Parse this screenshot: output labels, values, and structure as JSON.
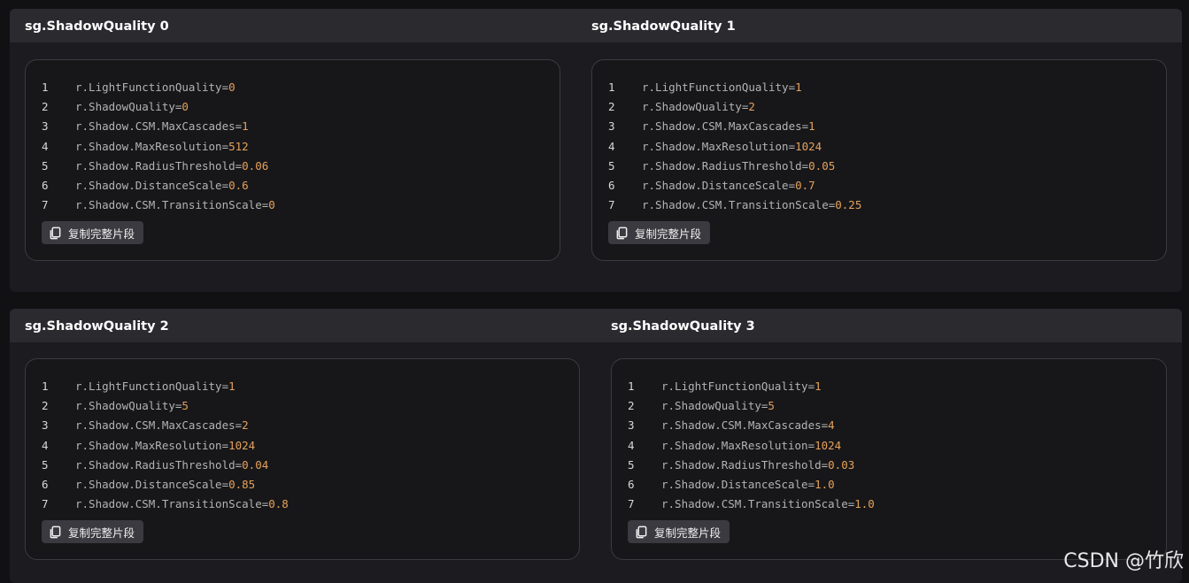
{
  "blocks": [
    {
      "columns": [
        {
          "title": "sg.ShadowQuality 0",
          "copy_label": "复制完整片段",
          "lines": [
            {
              "num": "1",
              "key": "r.LightFunctionQuality",
              "val": "0"
            },
            {
              "num": "2",
              "key": "r.ShadowQuality",
              "val": "0"
            },
            {
              "num": "3",
              "key": "r.Shadow.CSM.MaxCascades",
              "val": "1"
            },
            {
              "num": "4",
              "key": "r.Shadow.MaxResolution",
              "val": "512"
            },
            {
              "num": "5",
              "key": "r.Shadow.RadiusThreshold",
              "val": "0.06"
            },
            {
              "num": "6",
              "key": "r.Shadow.DistanceScale",
              "val": "0.6"
            },
            {
              "num": "7",
              "key": "r.Shadow.CSM.TransitionScale",
              "val": "0"
            }
          ]
        },
        {
          "title": "sg.ShadowQuality 1",
          "copy_label": "复制完整片段",
          "lines": [
            {
              "num": "1",
              "key": "r.LightFunctionQuality",
              "val": "1"
            },
            {
              "num": "2",
              "key": "r.ShadowQuality",
              "val": "2"
            },
            {
              "num": "3",
              "key": "r.Shadow.CSM.MaxCascades",
              "val": "1"
            },
            {
              "num": "4",
              "key": "r.Shadow.MaxResolution",
              "val": "1024"
            },
            {
              "num": "5",
              "key": "r.Shadow.RadiusThreshold",
              "val": "0.05"
            },
            {
              "num": "6",
              "key": "r.Shadow.DistanceScale",
              "val": "0.7"
            },
            {
              "num": "7",
              "key": "r.Shadow.CSM.TransitionScale",
              "val": "0.25"
            }
          ]
        }
      ]
    },
    {
      "columns": [
        {
          "title": "sg.ShadowQuality 2",
          "copy_label": "复制完整片段",
          "lines": [
            {
              "num": "1",
              "key": "r.LightFunctionQuality",
              "val": "1"
            },
            {
              "num": "2",
              "key": "r.ShadowQuality",
              "val": "5"
            },
            {
              "num": "3",
              "key": "r.Shadow.CSM.MaxCascades",
              "val": "2"
            },
            {
              "num": "4",
              "key": "r.Shadow.MaxResolution",
              "val": "1024"
            },
            {
              "num": "5",
              "key": "r.Shadow.RadiusThreshold",
              "val": "0.04"
            },
            {
              "num": "6",
              "key": "r.Shadow.DistanceScale",
              "val": "0.85"
            },
            {
              "num": "7",
              "key": "r.Shadow.CSM.TransitionScale",
              "val": "0.8"
            }
          ]
        },
        {
          "title": "sg.ShadowQuality 3",
          "copy_label": "复制完整片段",
          "lines": [
            {
              "num": "1",
              "key": "r.LightFunctionQuality",
              "val": "1"
            },
            {
              "num": "2",
              "key": "r.ShadowQuality",
              "val": "5"
            },
            {
              "num": "3",
              "key": "r.Shadow.CSM.MaxCascades",
              "val": "4"
            },
            {
              "num": "4",
              "key": "r.Shadow.MaxResolution",
              "val": "1024"
            },
            {
              "num": "5",
              "key": "r.Shadow.RadiusThreshold",
              "val": "0.03"
            },
            {
              "num": "6",
              "key": "r.Shadow.DistanceScale",
              "val": "1.0"
            },
            {
              "num": "7",
              "key": "r.Shadow.CSM.TransitionScale",
              "val": "1.0"
            }
          ]
        }
      ]
    }
  ],
  "icons": {
    "copy": "copy-icon"
  },
  "colors": {
    "value": "#e5a15a",
    "key": "#b3b3b3",
    "header_bg": "#2a2a2f"
  },
  "watermark": "CSDN @竹欣"
}
